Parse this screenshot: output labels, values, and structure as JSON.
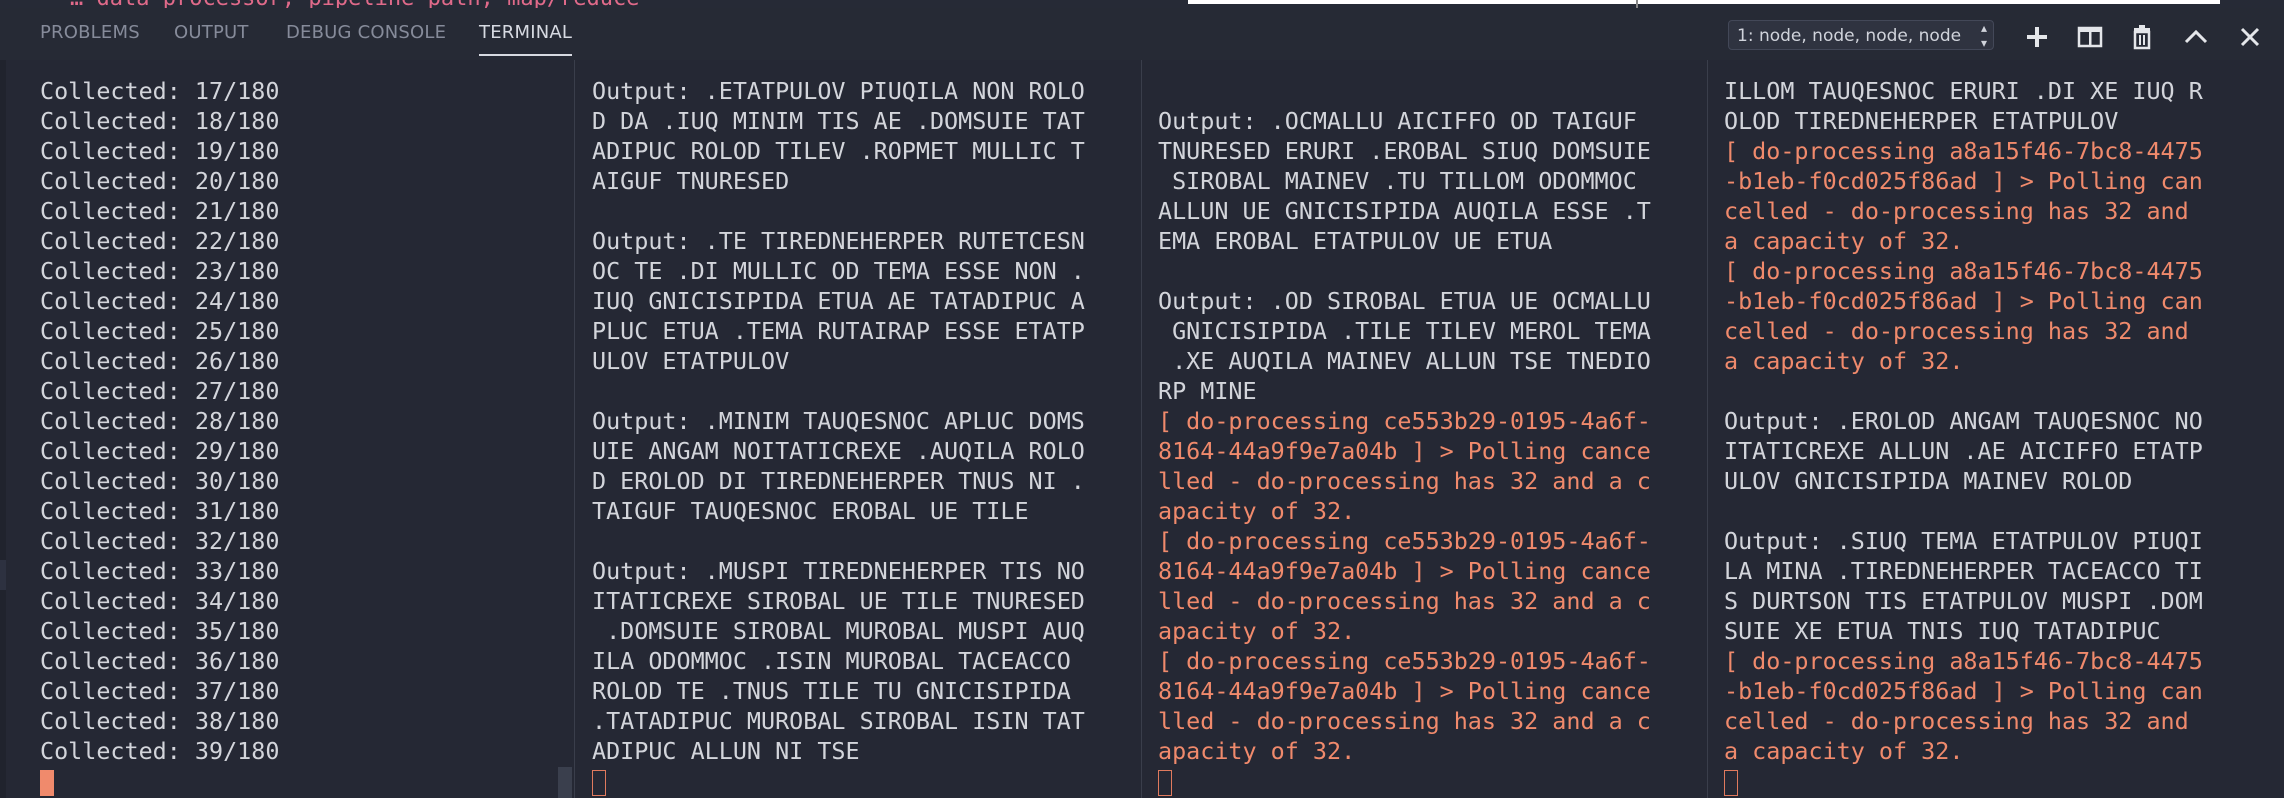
{
  "top_snippet": "… data_processor, pipeline_path, map/reduce",
  "tabs": [
    {
      "label": "PROBLEMS"
    },
    {
      "label": "OUTPUT"
    },
    {
      "label": "DEBUG CONSOLE"
    },
    {
      "label": "TERMINAL"
    }
  ],
  "terminal_select": {
    "value": "1: node, node, node, node"
  },
  "actions": [
    {
      "name": "new-terminal",
      "icon": "plus-icon"
    },
    {
      "name": "split-terminal",
      "icon": "split-icon"
    },
    {
      "name": "kill-terminal",
      "icon": "trash-icon"
    },
    {
      "name": "maximize-panel",
      "icon": "chevron-up-icon"
    },
    {
      "name": "close-panel",
      "icon": "close-icon"
    }
  ],
  "colors": {
    "background": "#252834",
    "text": "#d3d5db",
    "error": "#f08a6c",
    "accent_cursor": "#e07a5e"
  },
  "panes": [
    {
      "lines": [
        {
          "t": "Collected: 17/180"
        },
        {
          "t": "Collected: 18/180"
        },
        {
          "t": "Collected: 19/180"
        },
        {
          "t": "Collected: 20/180"
        },
        {
          "t": "Collected: 21/180"
        },
        {
          "t": "Collected: 22/180"
        },
        {
          "t": "Collected: 23/180"
        },
        {
          "t": "Collected: 24/180"
        },
        {
          "t": "Collected: 25/180"
        },
        {
          "t": "Collected: 26/180"
        },
        {
          "t": "Collected: 27/180"
        },
        {
          "t": "Collected: 28/180"
        },
        {
          "t": "Collected: 29/180"
        },
        {
          "t": "Collected: 30/180"
        },
        {
          "t": "Collected: 31/180"
        },
        {
          "t": "Collected: 32/180"
        },
        {
          "t": "Collected: 33/180"
        },
        {
          "t": "Collected: 34/180"
        },
        {
          "t": "Collected: 35/180"
        },
        {
          "t": "Collected: 36/180"
        },
        {
          "t": "Collected: 37/180"
        },
        {
          "t": "Collected: 38/180"
        },
        {
          "t": "Collected: 39/180"
        }
      ]
    },
    {
      "lines": [
        {
          "t": "Output: .ETATPULOV PIUQILA NON ROLO"
        },
        {
          "t": "D DA .IUQ MINIM TIS AE .DOMSUIE TAT"
        },
        {
          "t": "ADIPUC ROLOD TILEV .ROPMET MULLIC T"
        },
        {
          "t": "AIGUF TNURESED"
        },
        {
          "t": ""
        },
        {
          "t": "Output: .TE TIREDNEHERPER RUTETCESN"
        },
        {
          "t": "OC TE .DI MULLIC OD TEMA ESSE NON ."
        },
        {
          "t": "IUQ GNICISIPIDA ETUA AE TATADIPUC A"
        },
        {
          "t": "PLUC ETUA .TEMA RUTAIRAP ESSE ETATP"
        },
        {
          "t": "ULOV ETATPULOV"
        },
        {
          "t": ""
        },
        {
          "t": "Output: .MINIM TAUQESNOC APLUC DOMS"
        },
        {
          "t": "UIE ANGAM NOITATICREXE .AUQILA ROLO"
        },
        {
          "t": "D EROLOD DI TIREDNEHERPER TNUS NI ."
        },
        {
          "t": "TAIGUF TAUQESNOC EROBAL UE TILE"
        },
        {
          "t": ""
        },
        {
          "t": "Output: .MUSPI TIREDNEHERPER TIS NO"
        },
        {
          "t": "ITATICREXE SIROBAL UE TILE TNURESED"
        },
        {
          "t": " .DOMSUIE SIROBAL MUROBAL MUSPI AUQ"
        },
        {
          "t": "ILA ODOMMOC .ISIN MUROBAL TACEACCO"
        },
        {
          "t": "ROLOD TE .TNUS TILE TU GNICISIPIDA"
        },
        {
          "t": ".TATADIPUC MUROBAL SIROBAL ISIN TAT"
        },
        {
          "t": "ADIPUC ALLUN NI TSE"
        }
      ]
    },
    {
      "lines": [
        {
          "t": ""
        },
        {
          "t": "Output: .OCMALLU AICIFFO OD TAIGUF"
        },
        {
          "t": "TNURESED ERURI .EROBAL SIUQ DOMSUIE"
        },
        {
          "t": " SIROBAL MAINEV .TU TILLOM ODOMMOC"
        },
        {
          "t": "ALLUN UE GNICISIPIDA AUQILA ESSE .T"
        },
        {
          "t": "EMA EROBAL ETATPULOV UE ETUA"
        },
        {
          "t": ""
        },
        {
          "t": "Output: .OD SIROBAL ETUA UE OCMALLU"
        },
        {
          "t": " GNICISIPIDA .TILE TILEV MEROL TEMA"
        },
        {
          "t": " .XE AUQILA MAINEV ALLUN TSE TNEDIO"
        },
        {
          "t": "RP MINE"
        },
        {
          "t": "[ do-processing ce553b29-0195-4a6f-",
          "err": true
        },
        {
          "t": "8164-44a9f9e7a04b ] > Polling cance",
          "err": true
        },
        {
          "t": "lled - do-processing has 32 and a c",
          "err": true
        },
        {
          "t": "apacity of 32.",
          "err": true
        },
        {
          "t": "[ do-processing ce553b29-0195-4a6f-",
          "err": true
        },
        {
          "t": "8164-44a9f9e7a04b ] > Polling cance",
          "err": true
        },
        {
          "t": "lled - do-processing has 32 and a c",
          "err": true
        },
        {
          "t": "apacity of 32.",
          "err": true
        },
        {
          "t": "[ do-processing ce553b29-0195-4a6f-",
          "err": true
        },
        {
          "t": "8164-44a9f9e7a04b ] > Polling cance",
          "err": true
        },
        {
          "t": "lled - do-processing has 32 and a c",
          "err": true
        },
        {
          "t": "apacity of 32.",
          "err": true
        }
      ]
    },
    {
      "lines": [
        {
          "t": "ILLOM TAUQESNOC ERURI .DI XE IUQ R"
        },
        {
          "t": "OLOD TIREDNEHERPER ETATPULOV"
        },
        {
          "t": "[ do-processing a8a15f46-7bc8-4475",
          "err": true
        },
        {
          "t": "-b1eb-f0cd025f86ad ] > Polling can",
          "err": true
        },
        {
          "t": "celled - do-processing has 32 and",
          "err": true
        },
        {
          "t": "a capacity of 32.",
          "err": true
        },
        {
          "t": "[ do-processing a8a15f46-7bc8-4475",
          "err": true
        },
        {
          "t": "-b1eb-f0cd025f86ad ] > Polling can",
          "err": true
        },
        {
          "t": "celled - do-processing has 32 and",
          "err": true
        },
        {
          "t": "a capacity of 32.",
          "err": true
        },
        {
          "t": ""
        },
        {
          "t": "Output: .EROLOD ANGAM TAUQESNOC NO"
        },
        {
          "t": "ITATICREXE ALLUN .AE AICIFFO ETATP"
        },
        {
          "t": "ULOV GNICISIPIDA MAINEV ROLOD"
        },
        {
          "t": ""
        },
        {
          "t": "Output: .SIUQ TEMA ETATPULOV PIUQI"
        },
        {
          "t": "LA MINA .TIREDNEHERPER TACEACCO TI"
        },
        {
          "t": "S DURTSON TIS ETATPULOV MUSPI .DOM"
        },
        {
          "t": "SUIE XE ETUA TNIS IUQ TATADIPUC"
        },
        {
          "t": "[ do-processing a8a15f46-7bc8-4475",
          "err": true
        },
        {
          "t": "-b1eb-f0cd025f86ad ] > Polling can",
          "err": true
        },
        {
          "t": "celled - do-processing has 32 and",
          "err": true
        },
        {
          "t": "a capacity of 32.",
          "err": true
        }
      ]
    }
  ]
}
